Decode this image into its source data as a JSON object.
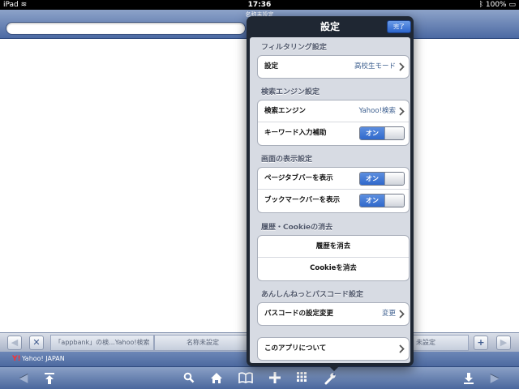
{
  "status_bar": {
    "device": "iPad",
    "time": "17:36",
    "battery": "100%"
  },
  "browser": {
    "page_title": "名称未設定",
    "tabs": [
      {
        "label": "「appbank」の検...Yahoo!検索"
      },
      {
        "label": "名称未設定"
      },
      {
        "label": "未設定"
      }
    ],
    "bookmark_label": "Yahoo! JAPAN",
    "bookmark_logo": "Y!"
  },
  "settings": {
    "title": "設定",
    "done_label": "完了",
    "sections": [
      {
        "header": "フィルタリング設定",
        "rows": [
          {
            "label": "設定",
            "value": "高校生モード"
          }
        ]
      },
      {
        "header": "検索エンジン設定",
        "rows": [
          {
            "label": "検索エンジン",
            "value": "Yahoo!検索"
          },
          {
            "label": "キーワード入力補助",
            "switch": "オン"
          }
        ]
      },
      {
        "header": "画面の表示設定",
        "rows": [
          {
            "label": "ページタブバーを表示",
            "switch": "オン"
          },
          {
            "label": "ブックマークバーを表示",
            "switch": "オン"
          }
        ]
      },
      {
        "header": "履歴・Cookieの消去",
        "rows": [
          {
            "label": "履歴を消去"
          },
          {
            "label": "Cookieを消去"
          }
        ]
      },
      {
        "header": "あんしんねっとパスコード設定",
        "rows": [
          {
            "label": "パスコードの設定変更",
            "value": "変更"
          }
        ]
      },
      {
        "rows": [
          {
            "label": "このアプリについて"
          }
        ]
      }
    ]
  },
  "icons": {
    "tab_add": "plus-icon",
    "tab_close": "close-icon",
    "toolbar": [
      "back-icon",
      "scroll-top-icon",
      "search-icon",
      "home-icon",
      "bookmarks-icon",
      "add-icon",
      "tabs-grid-icon",
      "settings-wrench-icon",
      "download-icon",
      "forward-icon"
    ]
  },
  "colors": {
    "accent": "#3a6fd0",
    "toolbar": "#5670a5",
    "popover": "#1f2733"
  }
}
